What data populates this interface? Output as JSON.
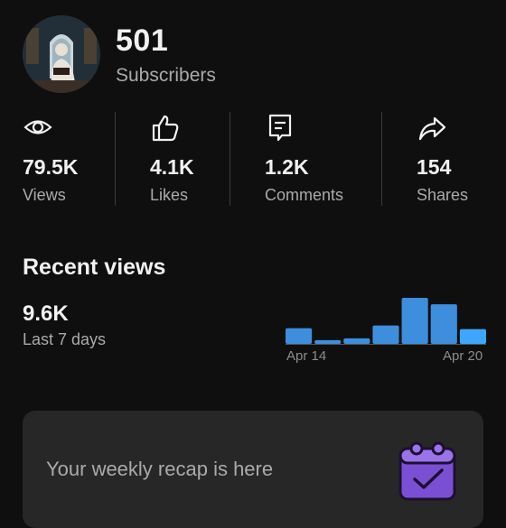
{
  "channel": {
    "count": "501",
    "count_label": "Subscribers"
  },
  "stats": [
    {
      "icon": "eye-icon",
      "value": "79.5K",
      "label": "Views"
    },
    {
      "icon": "thumbs-up-icon",
      "value": "4.1K",
      "label": "Likes"
    },
    {
      "icon": "comment-icon",
      "value": "1.2K",
      "label": "Comments"
    },
    {
      "icon": "share-icon",
      "value": "154",
      "label": "Shares"
    }
  ],
  "recent": {
    "title": "Recent views",
    "value": "9.6K",
    "period": "Last 7 days",
    "axis_start": "Apr 14",
    "axis_end": "Apr 20",
    "bars": [
      0.34,
      0.08,
      0.12,
      0.4,
      1.0,
      0.86,
      0.32
    ],
    "bar_color": "#3e8ede",
    "last_bar_color": "#3ea6ff"
  },
  "recap": {
    "text": "Your weekly recap is here",
    "icon": "calendar-check-icon"
  }
}
